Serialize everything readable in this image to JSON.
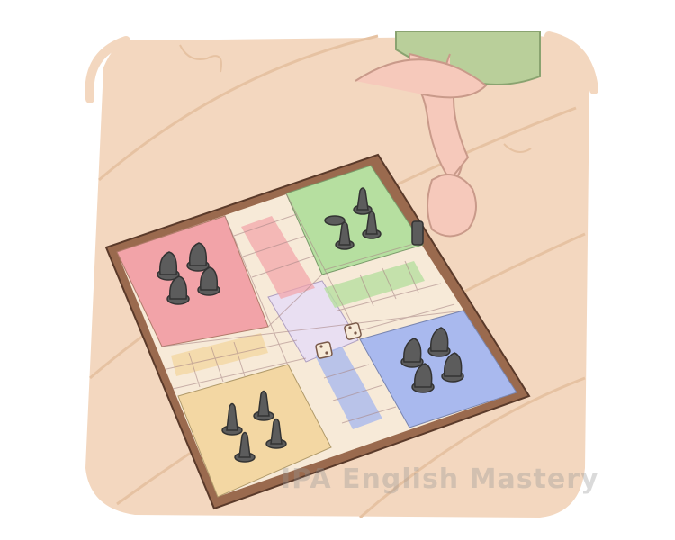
{
  "scene": {
    "subject": "ludo-board-game",
    "colors": {
      "background_floor": "#f3d7bf",
      "wood_stripe": "#e6c2a2",
      "board_frame": "#9a6a4e",
      "track_cream": "#f7ead8",
      "red_zone": "#f2a3a8",
      "green_zone": "#b6dfa0",
      "blue_zone": "#a9b9ee",
      "yellow_zone": "#f3d7a3",
      "center": "#e9dff2",
      "piece": "#5c5c5c"
    },
    "icons": [
      "die-icon",
      "hand-icon",
      "token-icon"
    ],
    "dice": {
      "count": 2
    },
    "pieces": {
      "red": 4,
      "green": 4,
      "blue": 4,
      "yellow": 4
    }
  },
  "watermark": {
    "text": "IPA English Mastery"
  }
}
